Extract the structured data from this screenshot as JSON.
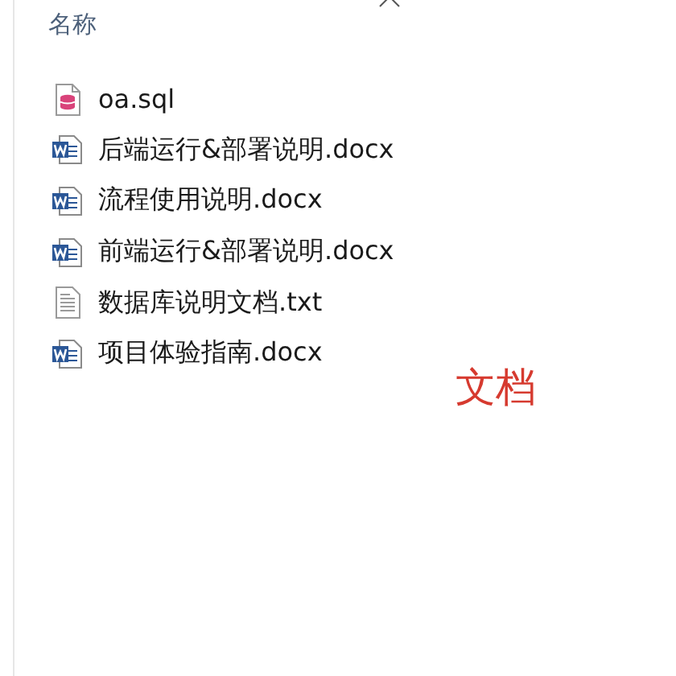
{
  "header": {
    "column": "名称"
  },
  "files": [
    {
      "name": "oa.sql",
      "kind": "sql"
    },
    {
      "name": "后端运行&部署说明.docx",
      "kind": "word"
    },
    {
      "name": "流程使用说明.docx",
      "kind": "word"
    },
    {
      "name": "前端运行&部署说明.docx",
      "kind": "word"
    },
    {
      "name": "数据库说明文档.txt",
      "kind": "text"
    },
    {
      "name": "项目体验指南.docx",
      "kind": "word"
    }
  ],
  "annotation": "文档"
}
